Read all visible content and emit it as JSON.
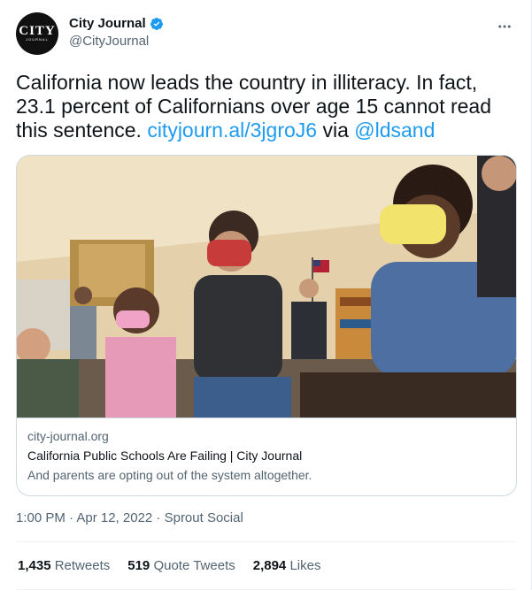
{
  "author": {
    "display_name": "City Journal",
    "handle": "@CityJournal",
    "avatar_text": "CITY",
    "avatar_subtext": "JOURNAL",
    "verified": true
  },
  "tweet": {
    "text_main": "California now leads the country in illiteracy. In fact, 23.1 percent of Californians over age 15 cannot read this sentence. ",
    "link_text": "cityjourn.al/3jgroJ6",
    "via_text": " via ",
    "mention_text": "@ldsand"
  },
  "card": {
    "domain": "city-journal.org",
    "title": "California Public Schools Are Failing | City Journal",
    "description": "And parents are opting out of the system altogether."
  },
  "meta": {
    "timestamp": "1:00 PM · Apr 12, 2022 · Sprout Social"
  },
  "stats": {
    "retweets_count": "1,435",
    "retweets_label": "Retweets",
    "quotes_count": "519",
    "quotes_label": "Quote Tweets",
    "likes_count": "2,894",
    "likes_label": "Likes"
  },
  "colors": {
    "link": "#1d9bf0",
    "verified": "#1d9bf0",
    "secondary_text": "#536471"
  },
  "icons": {
    "verified": "verified-badge-icon",
    "more": "more-horizontal-icon"
  }
}
